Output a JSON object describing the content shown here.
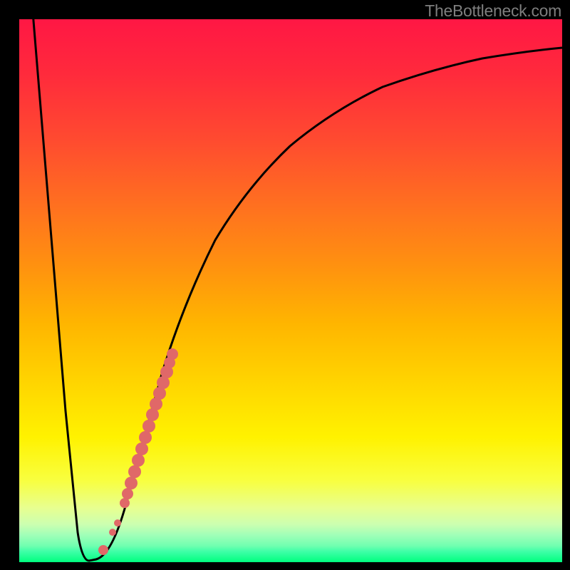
{
  "watermark": "TheBottleneck.com",
  "chart_data": {
    "type": "line",
    "title": "",
    "xlabel": "",
    "ylabel": "",
    "xlim": [
      0,
      100
    ],
    "ylim": [
      0,
      100
    ],
    "grid": false,
    "legend": false,
    "series": [
      {
        "name": "bottleneck-curve",
        "color": "#000000",
        "x": [
          0,
          2,
          4,
          6,
          8,
          10,
          11,
          12,
          13,
          14,
          16,
          18,
          20,
          24,
          28,
          32,
          36,
          40,
          46,
          52,
          58,
          64,
          72,
          80,
          90,
          100
        ],
        "y": [
          100,
          87,
          73,
          60,
          47,
          32,
          18,
          4,
          0,
          0,
          3,
          8,
          14,
          28,
          38,
          46,
          53,
          59,
          66,
          72,
          77,
          80,
          84,
          87,
          89,
          91
        ]
      }
    ],
    "highlight_points": {
      "name": "highlighted-range",
      "color": "#e57373",
      "points": [
        {
          "x": 15,
          "y": 2
        },
        {
          "x": 17,
          "y": 6
        },
        {
          "x": 18,
          "y": 8
        },
        {
          "x": 20,
          "y": 14
        },
        {
          "x": 21,
          "y": 17
        },
        {
          "x": 22,
          "y": 20
        },
        {
          "x": 23,
          "y": 24
        },
        {
          "x": 24,
          "y": 28
        },
        {
          "x": 25,
          "y": 31
        },
        {
          "x": 26,
          "y": 33
        },
        {
          "x": 27,
          "y": 36
        },
        {
          "x": 28,
          "y": 38
        }
      ]
    }
  }
}
